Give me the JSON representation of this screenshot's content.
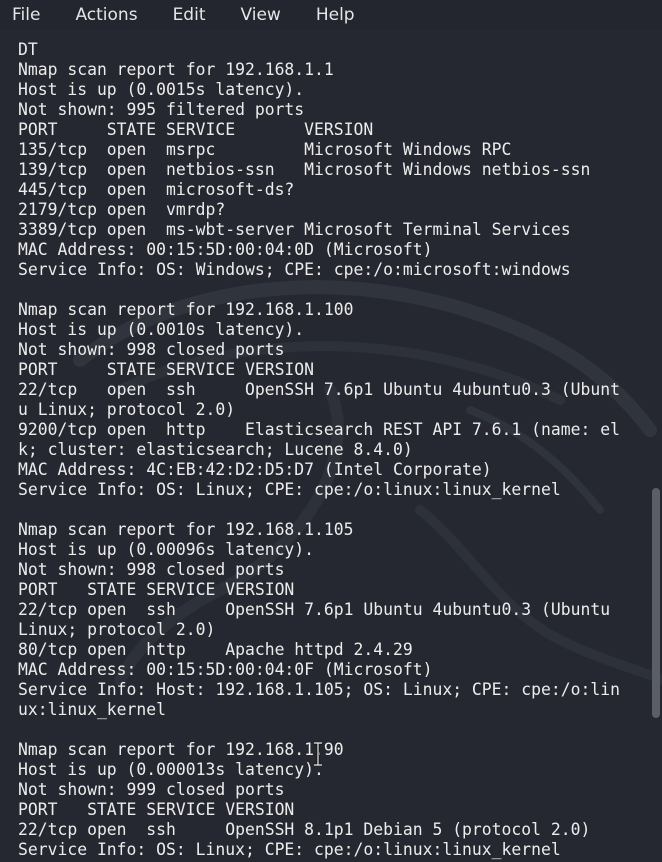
{
  "menu": [
    "File",
    "Actions",
    "Edit",
    "View",
    "Help"
  ],
  "terminal_lines": [
    "DT",
    "Nmap scan report for 192.168.1.1",
    "Host is up (0.0015s latency).",
    "Not shown: 995 filtered ports",
    "PORT     STATE SERVICE       VERSION",
    "135/tcp  open  msrpc         Microsoft Windows RPC",
    "139/tcp  open  netbios-ssn   Microsoft Windows netbios-ssn",
    "445/tcp  open  microsoft-ds?",
    "2179/tcp open  vmrdp?",
    "3389/tcp open  ms-wbt-server Microsoft Terminal Services",
    "MAC Address: 00:15:5D:00:04:0D (Microsoft)",
    "Service Info: OS: Windows; CPE: cpe:/o:microsoft:windows",
    "",
    "Nmap scan report for 192.168.1.100",
    "Host is up (0.0010s latency).",
    "Not shown: 998 closed ports",
    "PORT     STATE SERVICE VERSION",
    "22/tcp   open  ssh     OpenSSH 7.6p1 Ubuntu 4ubuntu0.3 (Ubunt",
    "u Linux; protocol 2.0)",
    "9200/tcp open  http    Elasticsearch REST API 7.6.1 (name: el",
    "k; cluster: elasticsearch; Lucene 8.4.0)",
    "MAC Address: 4C:EB:42:D2:D5:D7 (Intel Corporate)",
    "Service Info: OS: Linux; CPE: cpe:/o:linux:linux_kernel",
    "",
    "Nmap scan report for 192.168.1.105",
    "Host is up (0.00096s latency).",
    "Not shown: 998 closed ports",
    "PORT   STATE SERVICE VERSION",
    "22/tcp open  ssh     OpenSSH 7.6p1 Ubuntu 4ubuntu0.3 (Ubuntu",
    "Linux; protocol 2.0)",
    "80/tcp open  http    Apache httpd 2.4.29",
    "MAC Address: 00:15:5D:00:04:0F (Microsoft)",
    "Service Info: Host: 192.168.1.105; OS: Linux; CPE: cpe:/o:lin",
    "ux:linux_kernel",
    "",
    "Nmap scan report for 192.168.1.90",
    "Host is up (0.000013s latency).",
    "Not shown: 999 closed ports",
    "PORT   STATE SERVICE VERSION",
    "22/tcp open  ssh     OpenSSH 8.1p1 Debian 5 (protocol 2.0)",
    "Service Info: OS: Linux; CPE: cpe:/o:linux:linux_kernel"
  ],
  "colors": {
    "background": "#252830",
    "menubar": "#23262e",
    "text": "#ececec",
    "watermark": "#30343c",
    "scrollbar": "#5a5e66"
  },
  "icons": {
    "watermark": "kali-dragon-watermark-icon",
    "cursor": "text-cursor-icon"
  }
}
